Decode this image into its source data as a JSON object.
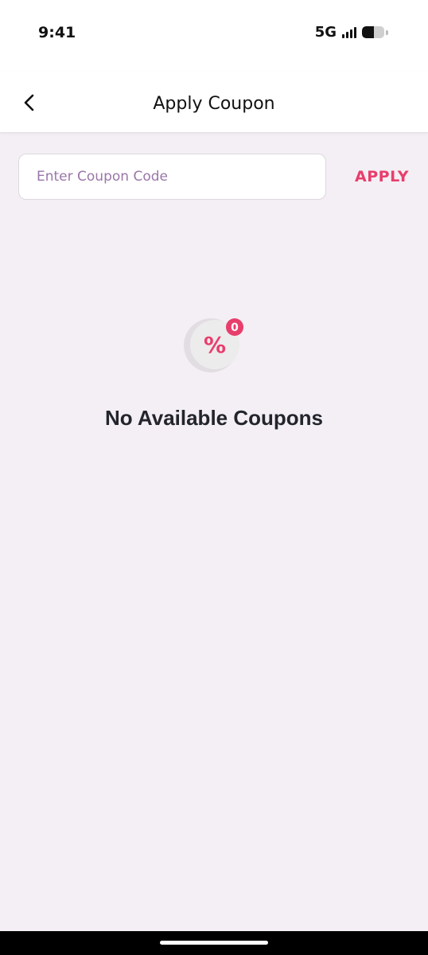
{
  "status_bar": {
    "time": "9:41",
    "network": "5G"
  },
  "header": {
    "title": "Apply Coupon"
  },
  "coupon": {
    "placeholder": "Enter Coupon Code",
    "value": "",
    "apply_label": "APPLY"
  },
  "empty_state": {
    "icon_symbol": "%",
    "badge_count": "0",
    "message": "No Available Coupons"
  },
  "colors": {
    "accent": "#e83e6c",
    "background": "#f4eff4",
    "placeholder": "#9a76a8",
    "text": "#23252d"
  }
}
